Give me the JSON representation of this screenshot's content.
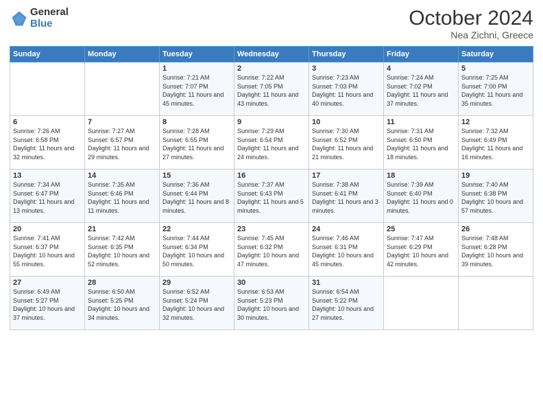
{
  "logo": {
    "general": "General",
    "blue": "Blue"
  },
  "header": {
    "month_year": "October 2024",
    "location": "Nea Zichni, Greece"
  },
  "days_of_week": [
    "Sunday",
    "Monday",
    "Tuesday",
    "Wednesday",
    "Thursday",
    "Friday",
    "Saturday"
  ],
  "weeks": [
    [
      {
        "day": "",
        "info": ""
      },
      {
        "day": "",
        "info": ""
      },
      {
        "day": "1",
        "info": "Sunrise: 7:21 AM\nSunset: 7:07 PM\nDaylight: 11 hours and 45 minutes."
      },
      {
        "day": "2",
        "info": "Sunrise: 7:22 AM\nSunset: 7:05 PM\nDaylight: 11 hours and 43 minutes."
      },
      {
        "day": "3",
        "info": "Sunrise: 7:23 AM\nSunset: 7:03 PM\nDaylight: 11 hours and 40 minutes."
      },
      {
        "day": "4",
        "info": "Sunrise: 7:24 AM\nSunset: 7:02 PM\nDaylight: 11 hours and 37 minutes."
      },
      {
        "day": "5",
        "info": "Sunrise: 7:25 AM\nSunset: 7:00 PM\nDaylight: 11 hours and 35 minutes."
      }
    ],
    [
      {
        "day": "6",
        "info": "Sunrise: 7:26 AM\nSunset: 6:58 PM\nDaylight: 11 hours and 32 minutes."
      },
      {
        "day": "7",
        "info": "Sunrise: 7:27 AM\nSunset: 6:57 PM\nDaylight: 11 hours and 29 minutes."
      },
      {
        "day": "8",
        "info": "Sunrise: 7:28 AM\nSunset: 6:55 PM\nDaylight: 11 hours and 27 minutes."
      },
      {
        "day": "9",
        "info": "Sunrise: 7:29 AM\nSunset: 6:54 PM\nDaylight: 11 hours and 24 minutes."
      },
      {
        "day": "10",
        "info": "Sunrise: 7:30 AM\nSunset: 6:52 PM\nDaylight: 11 hours and 21 minutes."
      },
      {
        "day": "11",
        "info": "Sunrise: 7:31 AM\nSunset: 6:50 PM\nDaylight: 11 hours and 18 minutes."
      },
      {
        "day": "12",
        "info": "Sunrise: 7:32 AM\nSunset: 6:49 PM\nDaylight: 11 hours and 16 minutes."
      }
    ],
    [
      {
        "day": "13",
        "info": "Sunrise: 7:34 AM\nSunset: 6:47 PM\nDaylight: 11 hours and 13 minutes."
      },
      {
        "day": "14",
        "info": "Sunrise: 7:35 AM\nSunset: 6:46 PM\nDaylight: 11 hours and 11 minutes."
      },
      {
        "day": "15",
        "info": "Sunrise: 7:36 AM\nSunset: 6:44 PM\nDaylight: 11 hours and 8 minutes."
      },
      {
        "day": "16",
        "info": "Sunrise: 7:37 AM\nSunset: 6:43 PM\nDaylight: 11 hours and 5 minutes."
      },
      {
        "day": "17",
        "info": "Sunrise: 7:38 AM\nSunset: 6:41 PM\nDaylight: 11 hours and 3 minutes."
      },
      {
        "day": "18",
        "info": "Sunrise: 7:39 AM\nSunset: 6:40 PM\nDaylight: 11 hours and 0 minutes."
      },
      {
        "day": "19",
        "info": "Sunrise: 7:40 AM\nSunset: 6:38 PM\nDaylight: 10 hours and 57 minutes."
      }
    ],
    [
      {
        "day": "20",
        "info": "Sunrise: 7:41 AM\nSunset: 6:37 PM\nDaylight: 10 hours and 55 minutes."
      },
      {
        "day": "21",
        "info": "Sunrise: 7:42 AM\nSunset: 6:35 PM\nDaylight: 10 hours and 52 minutes."
      },
      {
        "day": "22",
        "info": "Sunrise: 7:44 AM\nSunset: 6:34 PM\nDaylight: 10 hours and 50 minutes."
      },
      {
        "day": "23",
        "info": "Sunrise: 7:45 AM\nSunset: 6:32 PM\nDaylight: 10 hours and 47 minutes."
      },
      {
        "day": "24",
        "info": "Sunrise: 7:46 AM\nSunset: 6:31 PM\nDaylight: 10 hours and 45 minutes."
      },
      {
        "day": "25",
        "info": "Sunrise: 7:47 AM\nSunset: 6:29 PM\nDaylight: 10 hours and 42 minutes."
      },
      {
        "day": "26",
        "info": "Sunrise: 7:48 AM\nSunset: 6:28 PM\nDaylight: 10 hours and 39 minutes."
      }
    ],
    [
      {
        "day": "27",
        "info": "Sunrise: 6:49 AM\nSunset: 5:27 PM\nDaylight: 10 hours and 37 minutes."
      },
      {
        "day": "28",
        "info": "Sunrise: 6:50 AM\nSunset: 5:25 PM\nDaylight: 10 hours and 34 minutes."
      },
      {
        "day": "29",
        "info": "Sunrise: 6:52 AM\nSunset: 5:24 PM\nDaylight: 10 hours and 32 minutes."
      },
      {
        "day": "30",
        "info": "Sunrise: 6:53 AM\nSunset: 5:23 PM\nDaylight: 10 hours and 30 minutes."
      },
      {
        "day": "31",
        "info": "Sunrise: 6:54 AM\nSunset: 5:22 PM\nDaylight: 10 hours and 27 minutes."
      },
      {
        "day": "",
        "info": ""
      },
      {
        "day": "",
        "info": ""
      }
    ]
  ]
}
